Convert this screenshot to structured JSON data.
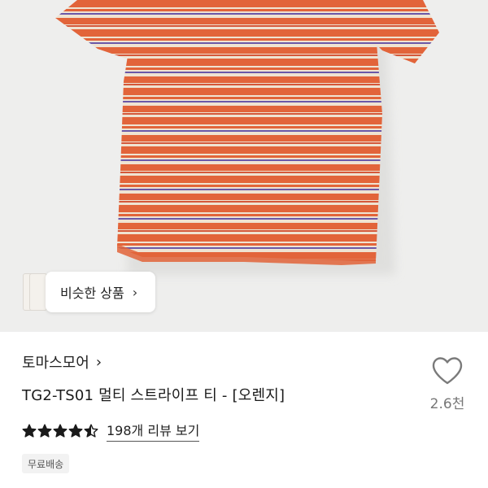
{
  "similar": {
    "label": "비슷한 상품",
    "chevron": "›"
  },
  "product": {
    "brand": "토마스모어",
    "brand_chevron": "›",
    "title": "TG2-TS01 멀티 스트라이프 티 - [오렌지]",
    "rating": 4.5,
    "rating_max": 5,
    "reviews_label": "198개 리뷰 보기",
    "badge": "무료배송"
  },
  "like": {
    "icon": "heart-outline-icon",
    "count": "2.6천"
  },
  "colors": {
    "orange": "#e2643a",
    "cream": "#efe3d2",
    "purple": "#6b58a8",
    "star": "#1a1a1a"
  }
}
